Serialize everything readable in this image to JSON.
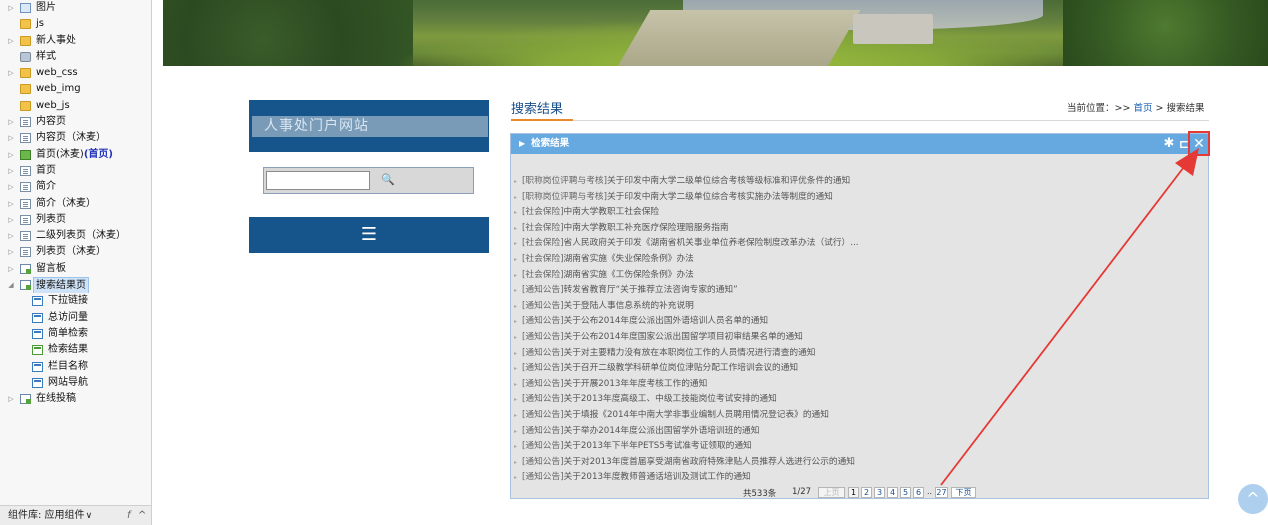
{
  "tree": {
    "items": [
      {
        "label": "图片",
        "icon": "image-folder-icon",
        "indent": 0,
        "toggle": "▷"
      },
      {
        "label": "js",
        "icon": "folder-icon",
        "indent": 0,
        "toggle": ""
      },
      {
        "label": "新人事处",
        "icon": "folder-icon",
        "indent": 0,
        "toggle": "▷"
      },
      {
        "label": "样式",
        "icon": "style-icon",
        "indent": 0,
        "toggle": ""
      },
      {
        "label": "web_css",
        "icon": "folder-icon",
        "indent": 0,
        "toggle": "▷"
      },
      {
        "label": "web_img",
        "icon": "folder-icon",
        "indent": 0,
        "toggle": ""
      },
      {
        "label": "web_js",
        "icon": "folder-icon",
        "indent": 0,
        "toggle": ""
      },
      {
        "label": "内容页",
        "icon": "page-icon",
        "indent": 0,
        "toggle": "▷"
      },
      {
        "label": "内容页（沐麦）",
        "icon": "page-icon",
        "indent": 0,
        "toggle": "▷"
      },
      {
        "label": "首页(沐麦)",
        "icon": "home-page-icon",
        "indent": 0,
        "toggle": "▷",
        "tag": "(首页)"
      },
      {
        "label": "首页",
        "icon": "page-icon",
        "indent": 0,
        "toggle": "▷"
      },
      {
        "label": "简介",
        "icon": "page-icon",
        "indent": 0,
        "toggle": "▷"
      },
      {
        "label": "简介（沐麦）",
        "icon": "page-icon",
        "indent": 0,
        "toggle": "▷"
      },
      {
        "label": "列表页",
        "icon": "page-icon",
        "indent": 0,
        "toggle": "▷"
      },
      {
        "label": "二级列表页（沐麦）",
        "icon": "page-icon",
        "indent": 0,
        "toggle": "▷"
      },
      {
        "label": "列表页（沐麦）",
        "icon": "page-icon",
        "indent": 0,
        "toggle": "▷"
      },
      {
        "label": "留言板",
        "icon": "guestbook-page-icon",
        "indent": 0,
        "toggle": "▷"
      },
      {
        "label": "搜索结果页",
        "icon": "guestbook-page-icon",
        "indent": 0,
        "toggle": "◢",
        "selected": true
      },
      {
        "label": "下拉链接",
        "icon": "component-icon",
        "indent": 1,
        "toggle": ""
      },
      {
        "label": "总访问量",
        "icon": "component-icon",
        "indent": 1,
        "toggle": ""
      },
      {
        "label": "简单检索",
        "icon": "component-icon",
        "indent": 1,
        "toggle": ""
      },
      {
        "label": "检索结果",
        "icon": "component-green-icon",
        "indent": 1,
        "toggle": ""
      },
      {
        "label": "栏目名称",
        "icon": "component-icon",
        "indent": 1,
        "toggle": ""
      },
      {
        "label": "网站导航",
        "icon": "component-icon",
        "indent": 1,
        "toggle": ""
      },
      {
        "label": "在线投稿",
        "icon": "guestbook-page-icon",
        "indent": 0,
        "toggle": "▷"
      }
    ],
    "footer": {
      "label": "组件库: 应用组件",
      "dropdown": "∨",
      "fx": "f",
      "collapse": "^"
    }
  },
  "site": {
    "title": "人事处门户网站",
    "search_placeholder": "",
    "search_icon": "🔍",
    "menu_icon": "☰"
  },
  "main": {
    "heading": "搜索结果",
    "breadcrumb": {
      "prefix": "当前位置：>>",
      "home": "首页",
      "sep": ">",
      "current": "搜索结果"
    }
  },
  "panel": {
    "title": "检索结果",
    "arrow": "▶",
    "gear": "✱",
    "max": "⊏",
    "close": "✕",
    "results": [
      {
        "cat": "[职称岗位评聘与考核]",
        "title": "关于印发中南大学二级单位综合考核等级标准和评优条件的通知"
      },
      {
        "cat": "[职称岗位评聘与考核]",
        "title": "关于印发中南大学二级单位综合考核实施办法等制度的通知"
      },
      {
        "cat": "[社会保险]",
        "title": "中南大学教职工社会保险"
      },
      {
        "cat": "[社会保险]",
        "title": "中南大学教职工补充医疗保险理赔服务指南"
      },
      {
        "cat": "[社会保险]",
        "title": "省人民政府关于印发《湖南省机关事业单位养老保险制度改革办法（试行）..."
      },
      {
        "cat": "[社会保险]",
        "title": "湖南省实施《失业保险条例》办法"
      },
      {
        "cat": "[社会保险]",
        "title": "湖南省实施《工伤保险条例》办法"
      },
      {
        "cat": "[通知公告]",
        "title": "转发省教育厅“关于推荐立法咨询专家的通知”"
      },
      {
        "cat": "[通知公告]",
        "title": "关于登陆人事信息系统的补充说明"
      },
      {
        "cat": "[通知公告]",
        "title": "关于公布2014年度公派出国外语培训人员名单的通知"
      },
      {
        "cat": "[通知公告]",
        "title": "关于公布2014年度国家公派出国留学项目初审结果名单的通知"
      },
      {
        "cat": "[通知公告]",
        "title": "关于对主要精力没有放在本职岗位工作的人员情况进行清查的通知"
      },
      {
        "cat": "[通知公告]",
        "title": "关于召开二级教学科研单位岗位津贴分配工作培训会议的通知"
      },
      {
        "cat": "[通知公告]",
        "title": "关于开展2013年年度考核工作的通知"
      },
      {
        "cat": "[通知公告]",
        "title": "关于2013年度高级工、中级工技能岗位考试安排的通知"
      },
      {
        "cat": "[通知公告]",
        "title": "关于填报《2014年中南大学非事业编制人员聘用情况登记表》的通知"
      },
      {
        "cat": "[通知公告]",
        "title": "关于举办2014年度公派出国留学外语培训班的通知"
      },
      {
        "cat": "[通知公告]",
        "title": "关于2013年下半年PETS5考试准考证领取的通知"
      },
      {
        "cat": "[通知公告]",
        "title": "关于对2013年度首届享受湖南省政府特殊津贴人员推荐人选进行公示的通知"
      },
      {
        "cat": "[通知公告]",
        "title": "关于2013年度教师普通话培训及测试工作的通知"
      }
    ],
    "pager": {
      "total": "共533条",
      "position": "1/27",
      "prev": "上页",
      "pages": [
        "1",
        "2",
        "3",
        "4",
        "5",
        "6"
      ],
      "dots": "..",
      "last": "27",
      "next": "下页"
    }
  },
  "colors": {
    "site_blue": "#16548c",
    "panel_head": "#66a9e0",
    "highlight_red": "#e53935",
    "link_blue": "#1a5fb4"
  },
  "scroll_top_icon": "^"
}
